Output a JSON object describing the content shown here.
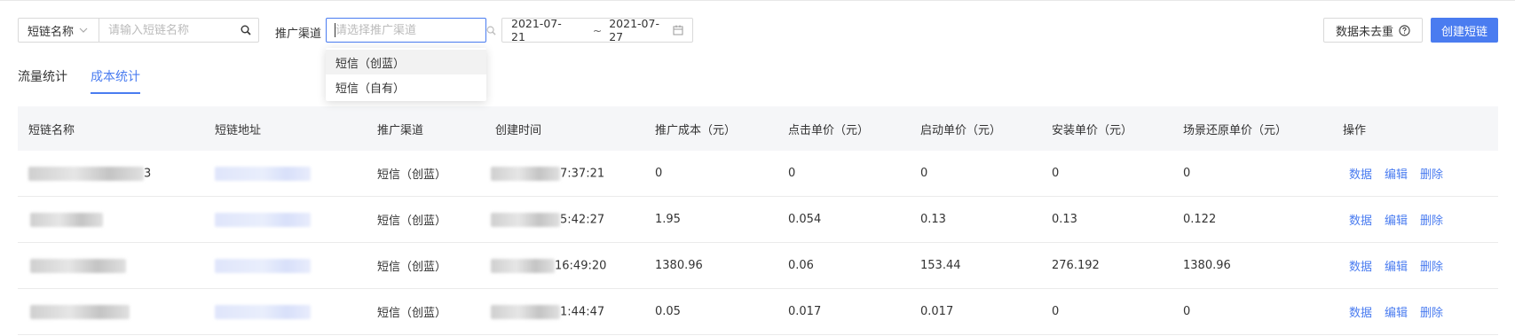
{
  "filters": {
    "search_type": "短链名称",
    "search_placeholder": "请输入短链名称",
    "channel_label": "推广渠道",
    "channel_placeholder": "请选择推广渠道",
    "date_start": "2021-07-21",
    "date_sep": "~",
    "date_end": "2021-07-27"
  },
  "buttons": {
    "dedupe": "数据未去重",
    "create": "创建短链"
  },
  "channel_options": [
    "短信（创蓝）",
    "短信（自有）"
  ],
  "tabs": [
    "流量统计",
    "成本统计"
  ],
  "active_tab": 1,
  "table": {
    "headers": [
      "短链名称",
      "短链地址",
      "推广渠道",
      "创建时间",
      "推广成本（元）",
      "点击单价（元）",
      "启动单价（元）",
      "安装单价（元）",
      "场景还原单价（元）",
      "操作"
    ],
    "rows": [
      {
        "name_suffix": "3",
        "channel": "短信（创蓝）",
        "time_suffix": "7:37:21",
        "cost": "0",
        "click": "0",
        "launch": "0",
        "install": "0",
        "scene": "0"
      },
      {
        "name_suffix": "",
        "channel": "短信（创蓝）",
        "time_suffix": "5:42:27",
        "cost": "1.95",
        "click": "0.054",
        "launch": "0.13",
        "install": "0.13",
        "scene": "0.122"
      },
      {
        "name_suffix": "",
        "channel": "短信（创蓝）",
        "time_suffix": "16:49:20",
        "cost": "1380.96",
        "click": "0.06",
        "launch": "153.44",
        "install": "276.192",
        "scene": "1380.96"
      },
      {
        "name_suffix": "",
        "channel": "短信（创蓝）",
        "time_suffix": "1:44:47",
        "cost": "0.05",
        "click": "0.017",
        "launch": "0.017",
        "install": "0",
        "scene": "0"
      }
    ],
    "actions": [
      "数据",
      "编辑",
      "删除"
    ]
  },
  "icons": {
    "search": "search-icon",
    "help": "question-circle-icon",
    "calendar": "calendar-icon",
    "chevron": "chevron-down-icon"
  },
  "colors": {
    "accent": "#4a7cf0",
    "header_bg": "#f5f6f8"
  }
}
